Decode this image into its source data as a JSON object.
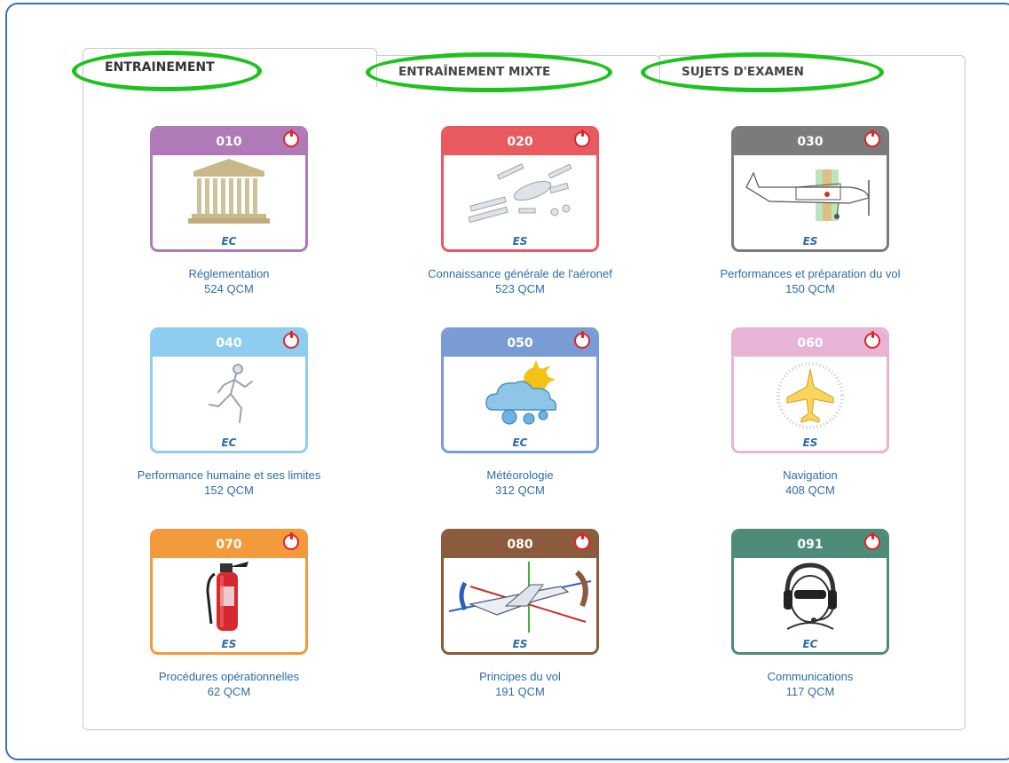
{
  "tabs": [
    {
      "label": "ENTRAINEMENT",
      "active": true
    },
    {
      "label": "ENTRAÎNEMENT MIXTE",
      "active": false
    },
    {
      "label": "SUJETS D'EXAMEN",
      "active": false
    }
  ],
  "highlight_color": "#1ec21e",
  "subjects": [
    {
      "code": "010",
      "type": "EC",
      "title": "Réglementation",
      "count": "524 QCM",
      "color": "#b07ab9",
      "icon": "courthouse-icon"
    },
    {
      "code": "020",
      "type": "ES",
      "title": "Connaissance générale de l'aéronef",
      "count": "523 QCM",
      "color": "#e85a5e",
      "icon": "aircraft-parts-icon"
    },
    {
      "code": "030",
      "type": "ES",
      "title": "Performances et préparation du vol",
      "count": "150 QCM",
      "color": "#7b7b7b",
      "icon": "airplane-balance-icon"
    },
    {
      "code": "040",
      "type": "EC",
      "title": "Performance humaine et ses limites",
      "count": "152 QCM",
      "color": "#8fcdf0",
      "icon": "runner-icon"
    },
    {
      "code": "050",
      "type": "EC",
      "title": "Météorologie",
      "count": "312 QCM",
      "color": "#7a9cd4",
      "icon": "weather-icon"
    },
    {
      "code": "060",
      "type": "ES",
      "title": "Navigation",
      "count": "408 QCM",
      "color": "#e7b4d6",
      "icon": "compass-airplane-icon"
    },
    {
      "code": "070",
      "type": "ES",
      "title": "Procédures opérationnelles",
      "count": "62 QCM",
      "color": "#f29a3c",
      "icon": "fire-extinguisher-icon"
    },
    {
      "code": "080",
      "type": "ES",
      "title": "Principes du vol",
      "count": "191 QCM",
      "color": "#8c5a3c",
      "icon": "airplane-axes-icon"
    },
    {
      "code": "091",
      "type": "EC",
      "title": "Communications",
      "count": "117 QCM",
      "color": "#4e8b78",
      "icon": "pilot-headset-icon"
    }
  ]
}
